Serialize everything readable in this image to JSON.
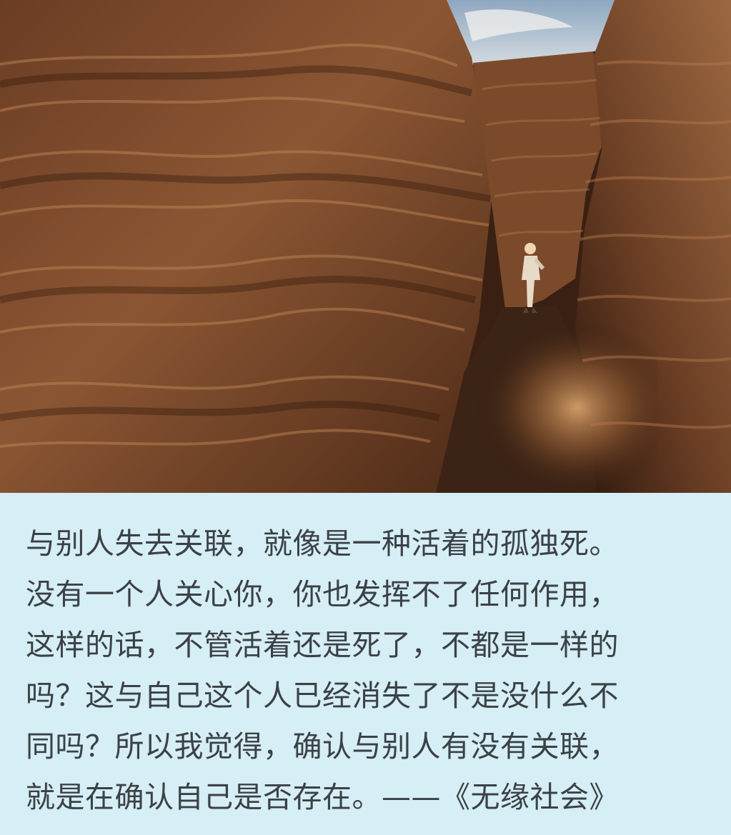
{
  "photo": {
    "subject": "canyon-photo"
  },
  "quote": {
    "lines": [
      "与别人失去关联，就像是一种活着的孤独死。",
      "没有一个人关心你，你也发挥不了任何作用，",
      "这样的话，不管活着还是死了，不都是一样的",
      "吗？这与自己这个人已经消失了不是没什么不",
      "同吗？所以我觉得，确认与别人有没有关联，",
      "就是在确认自己是否存在。——《无缘社会》"
    ]
  },
  "colors": {
    "panel_background": "#d6eef6",
    "text": "#3b4146",
    "rock_dark": "#3a2012",
    "rock_mid": "#8b5633",
    "rock_light": "#c58a58",
    "sky": "#9fb6cf"
  }
}
